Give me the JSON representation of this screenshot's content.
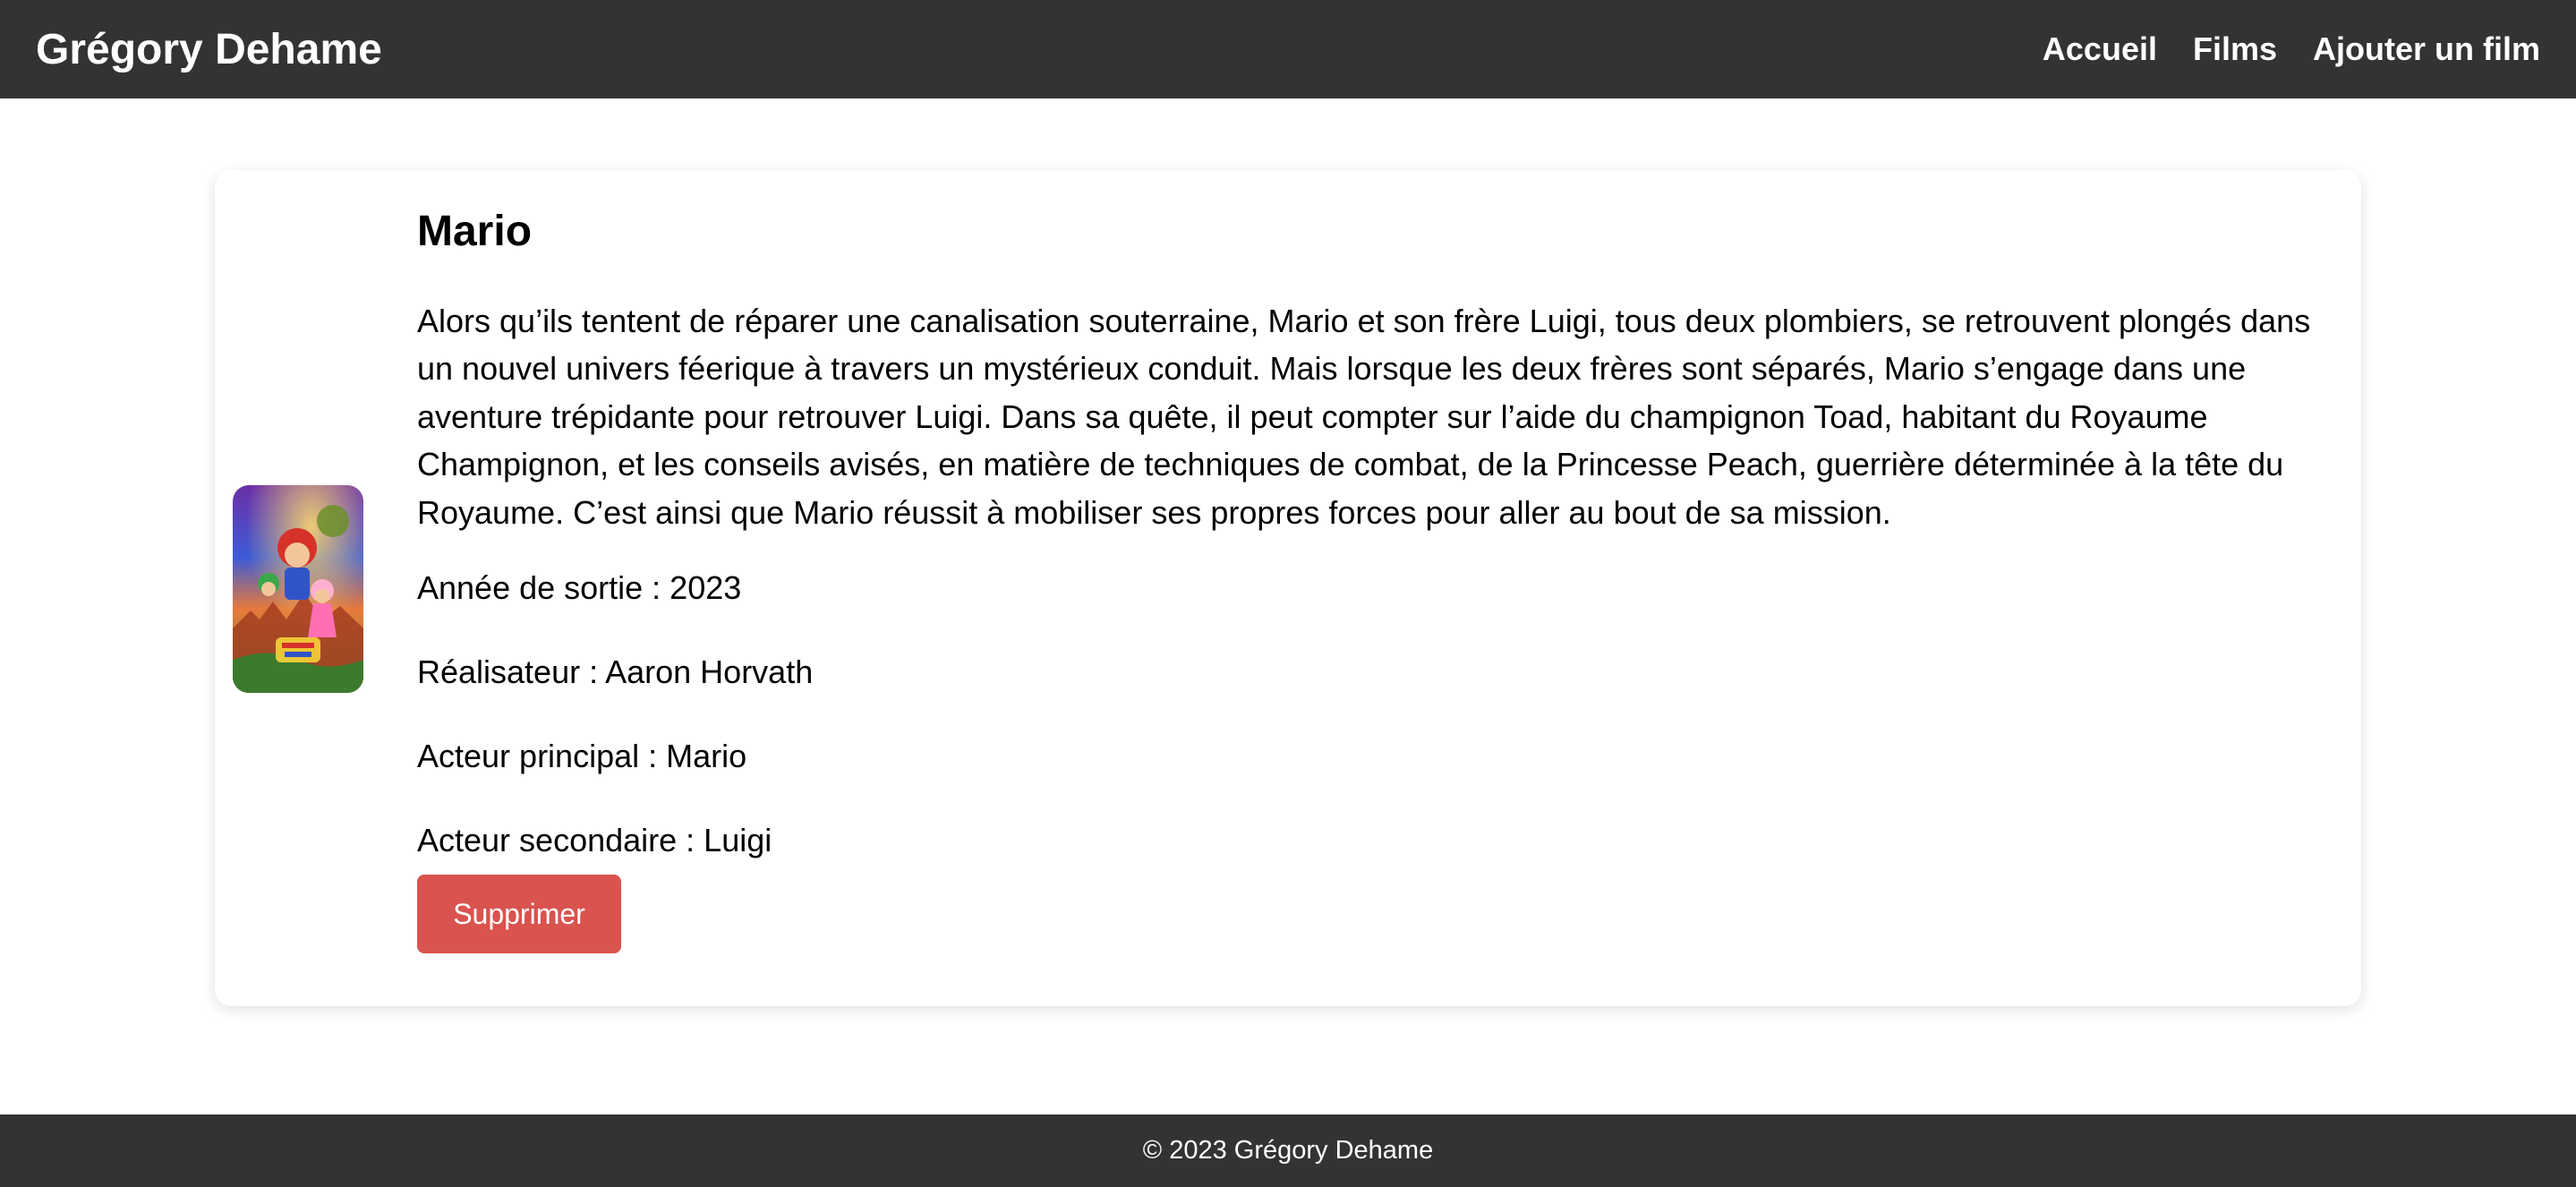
{
  "header": {
    "brand": "Grégory Dehame",
    "nav": [
      "Accueil",
      "Films",
      "Ajouter un film"
    ]
  },
  "movie": {
    "title": "Mario",
    "poster_icon": "movie-poster-image",
    "description": "Alors qu’ils tentent de réparer une canalisation souterraine, Mario et son frère Luigi, tous deux plombiers, se retrouvent plongés dans un nouvel univers féerique à travers un mystérieux conduit. Mais lorsque les deux frères sont séparés, Mario s’engage dans une aventure trépidante pour retrouver Luigi. Dans sa quête, il peut compter sur l’aide du champignon Toad, habitant du Royaume Champignon, et les conseils avisés, en matière de techniques de combat, de la Princesse Peach, guerrière déterminée à la tête du Royaume. C’est ainsi que Mario réussit à mobiliser ses propres forces pour aller au bout de sa mission.",
    "year": "Année de sortie : 2023",
    "director": "Réalisateur : Aaron Horvath",
    "main_actor": "Acteur principal : Mario",
    "secondary_actor": "Acteur secondaire : Luigi",
    "delete_label": "Supprimer"
  },
  "footer": {
    "text": "© 2023 Grégory Dehame"
  },
  "colors": {
    "header_bg": "#333333",
    "footer_bg": "#333333",
    "delete_button": "#d9534f"
  }
}
